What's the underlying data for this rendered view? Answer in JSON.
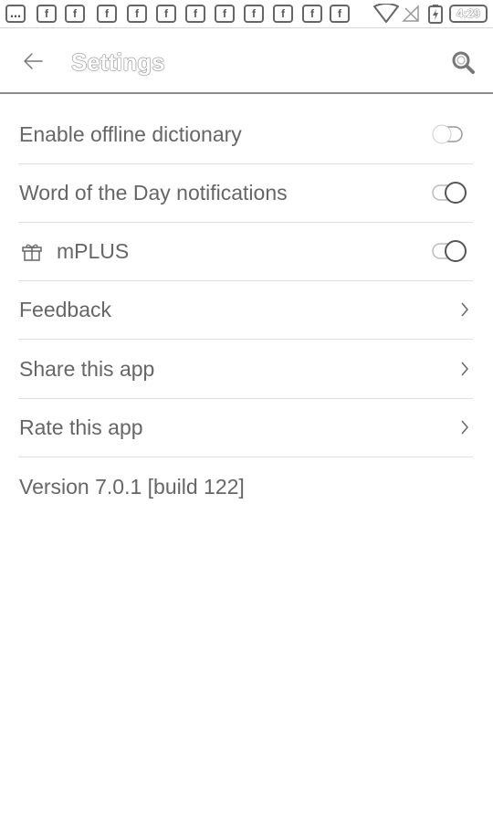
{
  "status_bar": {
    "notification_icons": [
      "…",
      "f",
      "f",
      "f",
      "f",
      "f",
      "f",
      "f",
      "f",
      "f",
      "f",
      "f"
    ],
    "time": "4:29"
  },
  "app_bar": {
    "title": "Settings"
  },
  "settings": [
    {
      "label": "Enable offline dictionary",
      "control": "toggle",
      "on": false
    },
    {
      "label": "Word of the Day notifications",
      "control": "toggle",
      "on": true
    },
    {
      "label": "mPLUS",
      "control": "toggle",
      "on": true,
      "icon": "gift-icon"
    },
    {
      "label": "Feedback",
      "control": "chevron"
    },
    {
      "label": "Share this app",
      "control": "chevron"
    },
    {
      "label": "Rate this app",
      "control": "chevron"
    }
  ],
  "version": "Version 7.0.1 [build 122]"
}
